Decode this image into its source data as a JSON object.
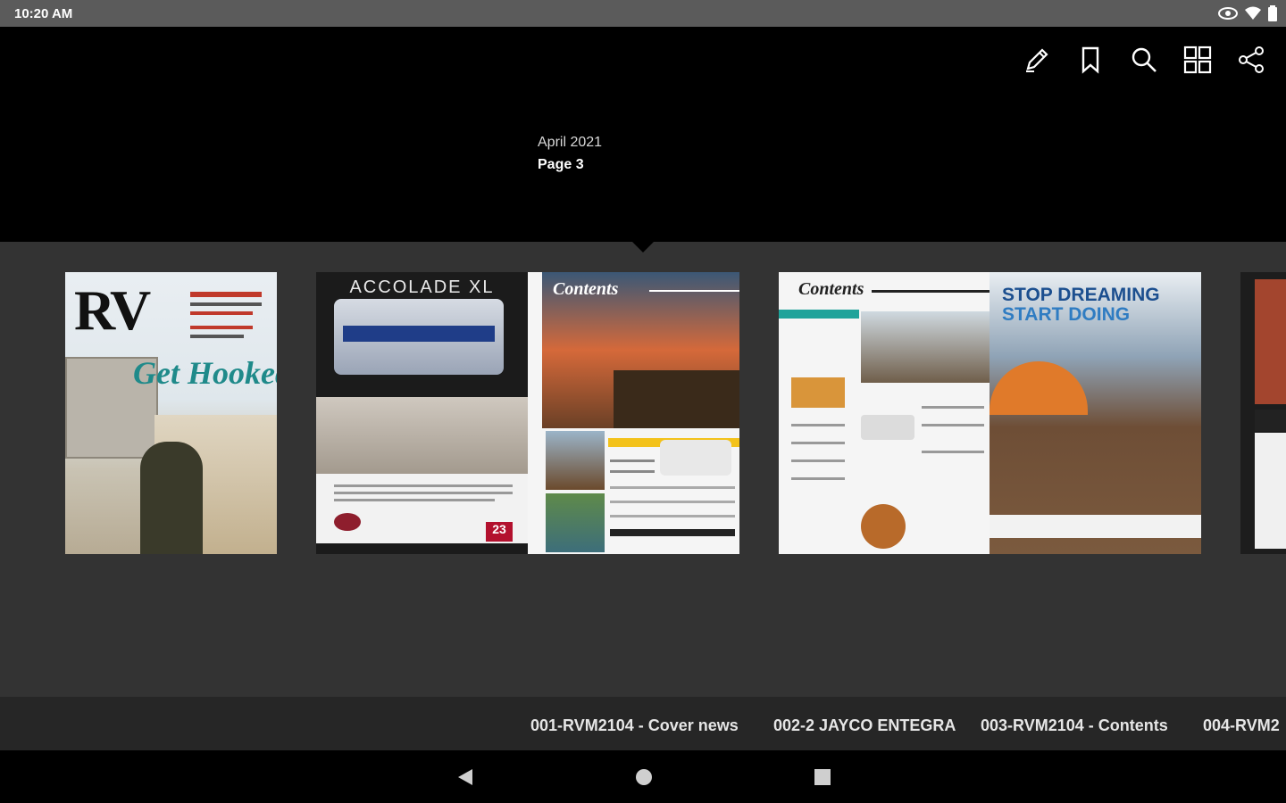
{
  "status_bar": {
    "time": "10:20 AM"
  },
  "toolbar": {
    "icons": [
      "annotate-icon",
      "bookmark-icon",
      "search-icon",
      "thumbnails-grid-icon",
      "share-icon"
    ]
  },
  "issue": {
    "date": "April 2021",
    "page": "Page 3"
  },
  "pages": {
    "cover": {
      "title": "RV",
      "headline": "Get Hooked!"
    },
    "ad": {
      "title": "ACCOLADE XL",
      "page_number": "23"
    },
    "contents": {
      "title": "Contents"
    },
    "spread": {
      "title": "Contents",
      "headline_1": "STOP DREAMING",
      "headline_2": "START DOING"
    }
  },
  "page_labels": [
    "001-RVM2104 - Cover news",
    "002-2 JAYCO ENTEGRA",
    "003-RVM2104 - Contents",
    "004-RVM2"
  ],
  "colors": {
    "status_bar": "#5b5b5b",
    "strip": "#333333",
    "labels_bar": "#262626",
    "teal_headline": "#1f8a8a",
    "blue_headline": "#1c4f8f"
  }
}
